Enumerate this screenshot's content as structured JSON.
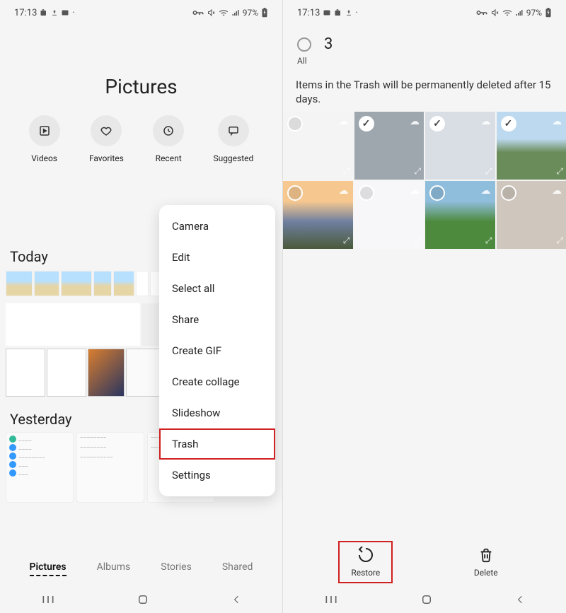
{
  "left": {
    "status": {
      "time": "17:13",
      "battery": "97%"
    },
    "title": "Pictures",
    "categories": [
      {
        "label": "Videos"
      },
      {
        "label": "Favorites"
      },
      {
        "label": "Recent"
      },
      {
        "label": "Suggested"
      }
    ],
    "sections": {
      "today": "Today",
      "yesterday": "Yesterday"
    },
    "menu": [
      "Camera",
      "Edit",
      "Select all",
      "Share",
      "Create GIF",
      "Create collage",
      "Slideshow",
      "Trash",
      "Settings"
    ],
    "menu_highlighted": "Trash",
    "tabs": [
      "Pictures",
      "Albums",
      "Stories",
      "Shared"
    ],
    "active_tab": "Pictures"
  },
  "right": {
    "status": {
      "time": "17:13",
      "battery": "97%"
    },
    "selection": {
      "count": "3",
      "all_label": "All"
    },
    "note": "Items in the Trash will be permanently deleted after 15 days.",
    "tiles_selected": [
      false,
      true,
      true,
      true,
      false,
      false,
      false,
      false
    ],
    "actions": {
      "restore": "Restore",
      "delete": "Delete"
    },
    "highlighted_action": "Restore"
  }
}
